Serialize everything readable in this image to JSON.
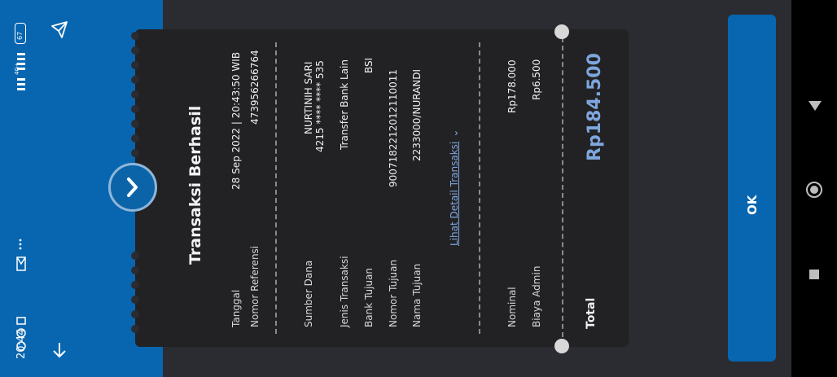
{
  "status_bar": {
    "time": "20:44",
    "battery": "67",
    "network": "4G+"
  },
  "receipt": {
    "title": "Transaksi Berhasil",
    "rows_top": [
      {
        "label": "Tanggal",
        "value": "28 Sep 2022 | 20:43:50 WIB"
      },
      {
        "label": "Nomor Referensi",
        "value": "473956266764"
      }
    ],
    "sumber_dana": {
      "label": "Sumber Dana",
      "value_line1": "NURTINIH SARI",
      "value_line2": "4215 **** **** 535"
    },
    "rows_mid": [
      {
        "label": "Jenis Transaksi",
        "value": "Transfer Bank Lain"
      },
      {
        "label": "Bank Tujuan",
        "value": "BSI"
      },
      {
        "label": "Nomor Tujuan",
        "value": "9007182212012110011"
      },
      {
        "label": "Nama Tujuan",
        "value": "2233000/NURANDI"
      }
    ],
    "detail_link": "Lihat Detail Transaksi",
    "rows_amount": [
      {
        "label": "Nominal",
        "value": "Rp178.000"
      },
      {
        "label": "Biaya Admin",
        "value": "Rp6.500"
      }
    ],
    "total_label": "Total",
    "total_value": "Rp184.500"
  },
  "ok_button": "OK",
  "colors": {
    "primary": "#0866b0",
    "accent": "#7ea6dc",
    "background": "#2b2c31",
    "card": "#222225"
  }
}
